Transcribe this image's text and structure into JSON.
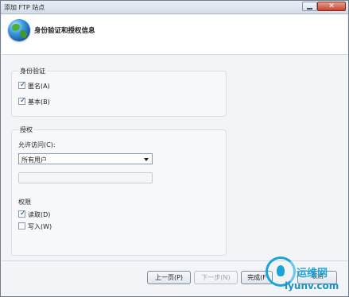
{
  "window": {
    "title": "添加 FTP 站点",
    "close_glyph": "✕",
    "heading": "身份验证和授权信息",
    "icon": "globe-icon"
  },
  "authentication": {
    "group_label": "身份验证",
    "options": [
      {
        "label": "匿名(A)",
        "checked": true
      },
      {
        "label": "基本(B)",
        "checked": true
      }
    ]
  },
  "authorization": {
    "group_label": "授权",
    "allow_access_label": "允许访问(C):",
    "allow_access_value": "所有用户",
    "text_value": "",
    "permissions_label": "权限",
    "permissions": [
      {
        "label": "读取(D)",
        "checked": true
      },
      {
        "label": "写入(W)",
        "checked": false
      }
    ]
  },
  "buttons": {
    "previous": "上一页(P)",
    "next": "下一步(N)",
    "finish": "完成(F",
    "cancel": "取消"
  },
  "watermark": {
    "line1": "运维网",
    "line2": "iyunv.com"
  },
  "colors": {
    "accent": "#1aa4d8",
    "close": "#c8412c"
  }
}
